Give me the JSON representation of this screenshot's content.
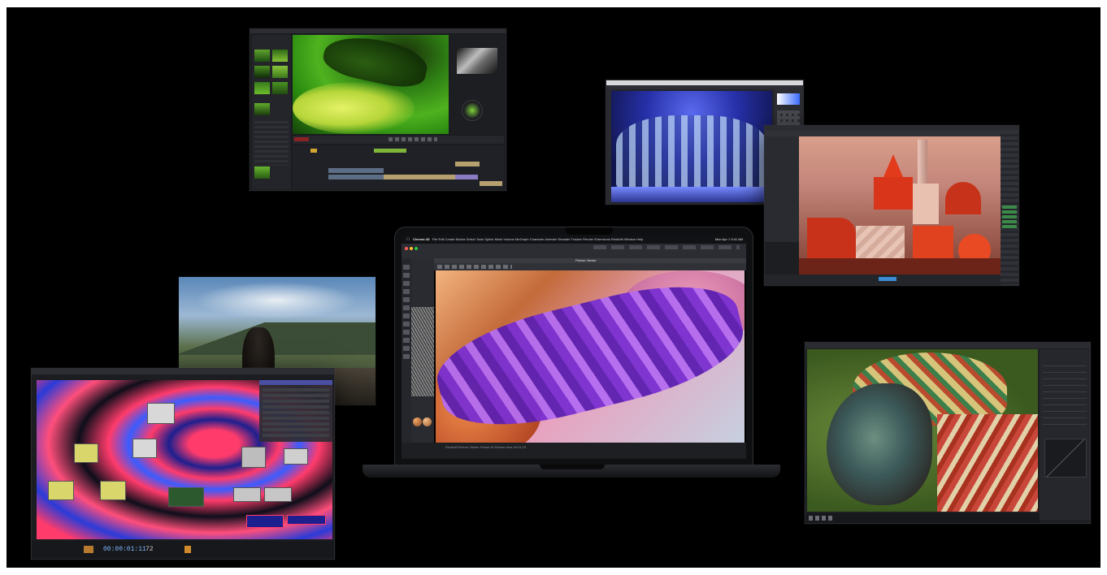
{
  "laptop": {
    "menubar": {
      "app": "Cinema 4D",
      "menus": [
        "File",
        "Edit",
        "Create",
        "Modes",
        "Select",
        "Tools",
        "Spline",
        "Mesh",
        "Volume",
        "MoGraph",
        "Character",
        "Animate",
        "Simulate",
        "Tracker",
        "Render",
        "Extensions",
        "Redshift",
        "Window",
        "Help"
      ],
      "clock": "Mon Apr 1  9:41 AM"
    },
    "viewer_title": "Picture Viewer",
    "status_text": "Redshift Picture Viewer  Frame 90  Render time 00:01:23"
  },
  "window_nuke": {
    "timecode": "00:00:01:11",
    "frame": "72"
  }
}
